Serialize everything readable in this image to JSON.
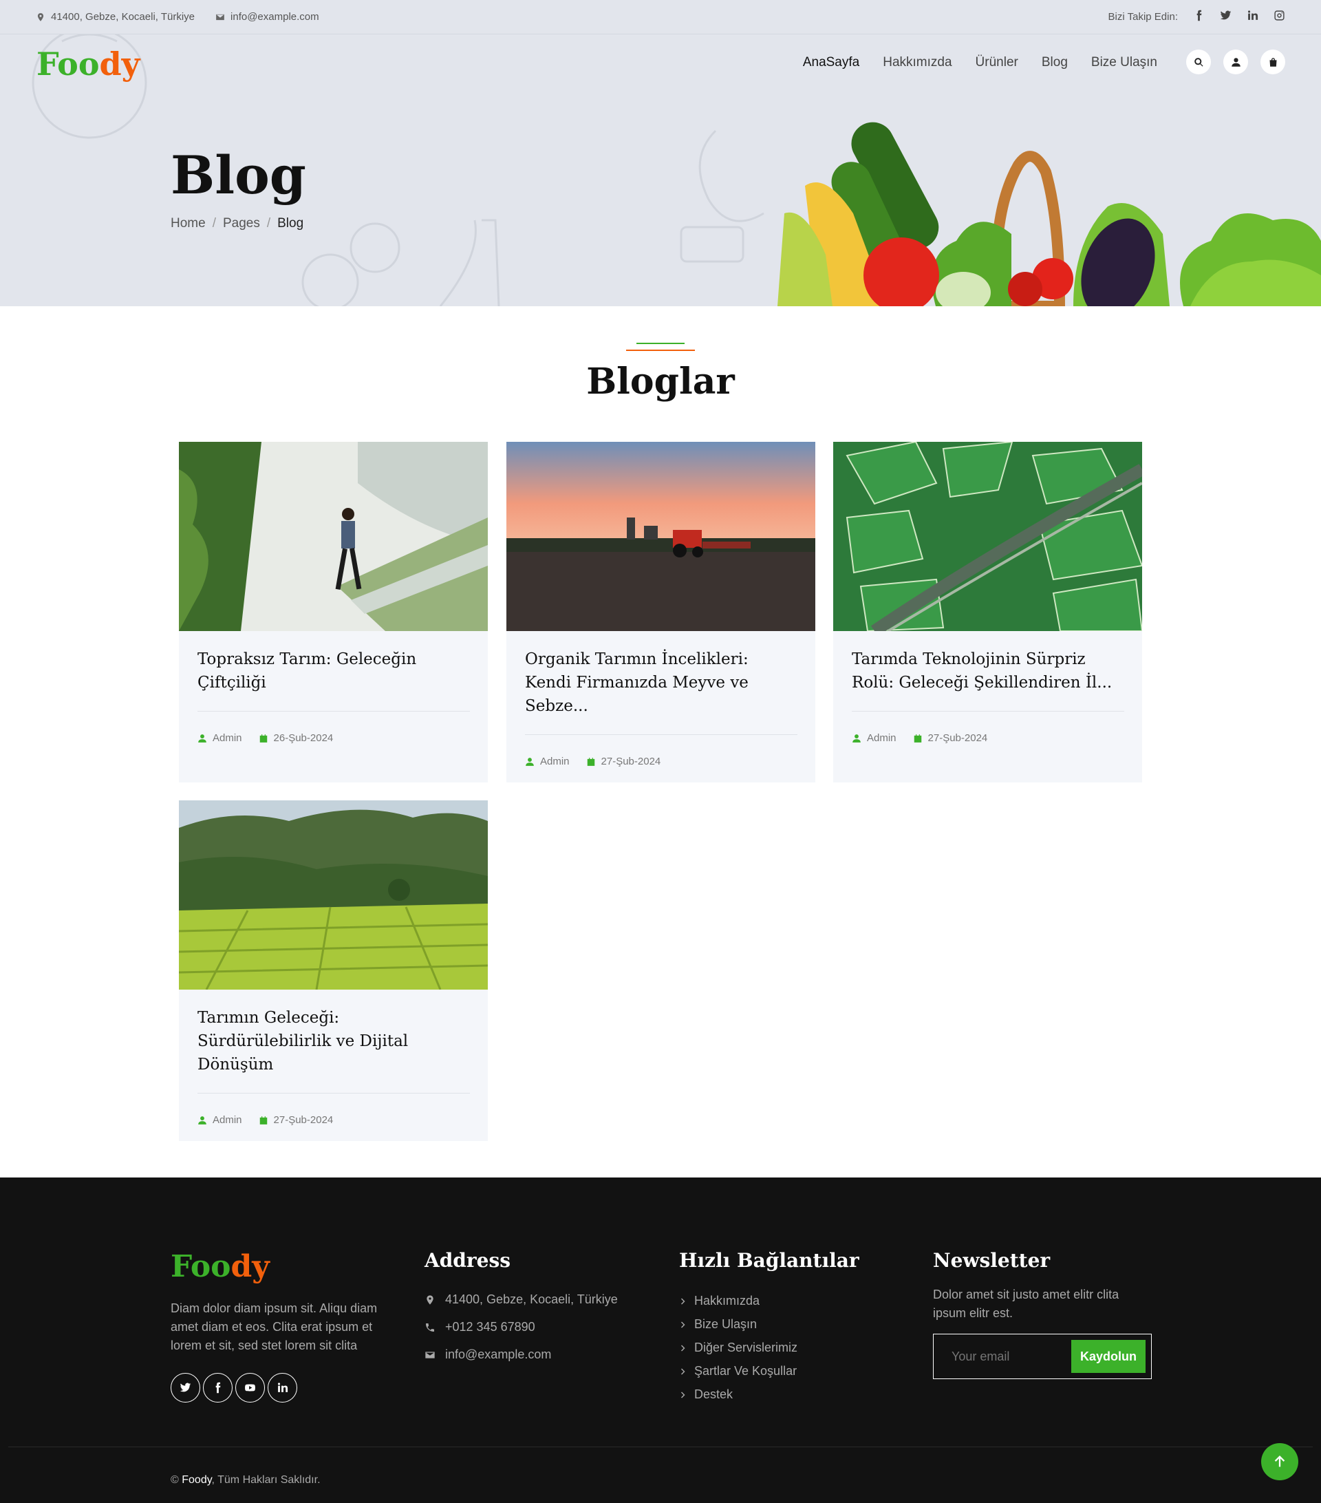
{
  "topbar": {
    "address": "41400, Gebze, Kocaeli, Türkiye",
    "email": "info@example.com",
    "follow_label": "Bizi Takip Edin:"
  },
  "brand": {
    "part1": "Foo",
    "part2": "dy"
  },
  "nav": [
    {
      "label": "AnaSayfa"
    },
    {
      "label": "Hakkımızda"
    },
    {
      "label": "Ürünler"
    },
    {
      "label": "Blog"
    },
    {
      "label": "Bize Ulaşın"
    }
  ],
  "hero": {
    "title": "Blog",
    "breadcrumb": [
      "Home",
      "Pages",
      "Blog"
    ],
    "separator": "/"
  },
  "section": {
    "title": "Bloglar"
  },
  "posts": [
    {
      "title": "Topraksız Tarım: Geleceğin Çiftçiliği",
      "author": "Admin",
      "date": "26-Şub-2024"
    },
    {
      "title": "Organik Tarımın İncelikleri: Kendi Firmanızda Meyve ve Sebze...",
      "author": "Admin",
      "date": "27-Şub-2024"
    },
    {
      "title": "Tarımda Teknolojinin Sürpriz Rolü: Geleceği Şekillendiren İl...",
      "author": "Admin",
      "date": "27-Şub-2024"
    },
    {
      "title": "Tarımın Geleceği: Sürdürülebilirlik ve Dijital Dönüşüm",
      "author": "Admin",
      "date": "27-Şub-2024"
    }
  ],
  "footer": {
    "about": "Diam dolor diam ipsum sit. Aliqu diam amet diam et eos. Clita erat ipsum et lorem et sit, sed stet lorem sit clita",
    "address_heading": "Address",
    "address": "41400, Gebze, Kocaeli, Türkiye",
    "phone": "+012 345 67890",
    "email": "info@example.com",
    "links_heading": "Hızlı Bağlantılar",
    "links": [
      "Hakkımızda",
      "Bize Ulaşın",
      "Diğer Servislerimiz",
      "Şartlar Ve Koşullar",
      "Destek"
    ],
    "newsletter_heading": "Newsletter",
    "newsletter_text": "Dolor amet sit justo amet elitr clita ipsum elitr est.",
    "email_placeholder": "Your email",
    "subscribe_label": "Kaydolun",
    "copyright_symbol": "©",
    "copyright_brand": "Foody",
    "copyright_text": ", Tüm Hakları Saklıdır."
  },
  "colors": {
    "green": "#3cb12a",
    "orange": "#f2600c",
    "hero_bg": "#e2e5ec",
    "footer_bg": "#121212"
  },
  "icons": [
    "map-marker-icon",
    "envelope-icon",
    "facebook-icon",
    "twitter-icon",
    "linkedin-icon",
    "instagram-icon",
    "search-icon",
    "user-icon",
    "shopping-bag-icon",
    "calendar-icon",
    "phone-icon",
    "chevron-right-icon",
    "youtube-icon",
    "arrow-up-icon"
  ]
}
